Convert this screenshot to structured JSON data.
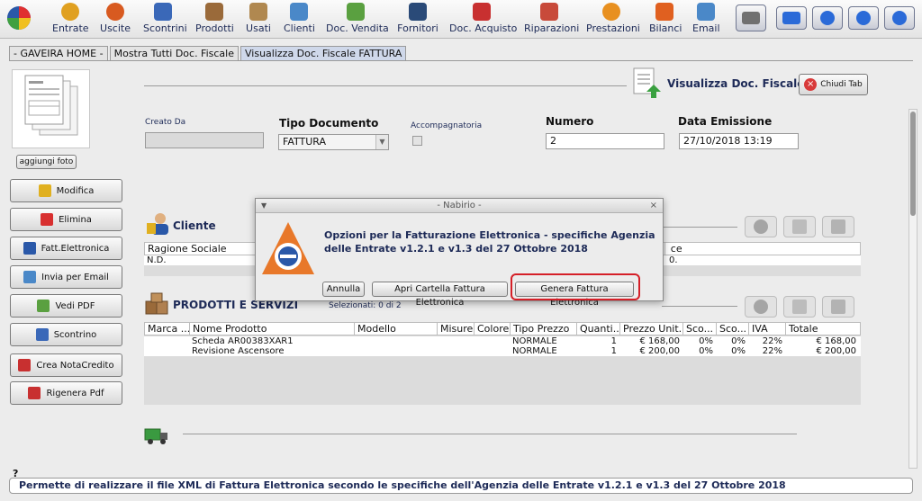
{
  "toolbar": {
    "items": [
      {
        "label": "Entrate",
        "icon": "coin-in-icon",
        "color": "#e0a020"
      },
      {
        "label": "Uscite",
        "icon": "coin-out-icon",
        "color": "#d85a20"
      },
      {
        "label": "Scontrini",
        "icon": "receipt-icon",
        "color": "#3a68b8"
      },
      {
        "label": "Prodotti",
        "icon": "boxes-icon",
        "color": "#9a6a3a"
      },
      {
        "label": "Usati",
        "icon": "open-box-icon",
        "color": "#b08850"
      },
      {
        "label": "Clienti",
        "icon": "customer-icon",
        "color": "#4a88c8"
      },
      {
        "label": "Doc. Vendita",
        "icon": "sale-document-icon",
        "color": "#5aa040"
      },
      {
        "label": "Fornitori",
        "icon": "suppliers-icon",
        "color": "#2a4a78"
      },
      {
        "label": "Doc. Acquisto",
        "icon": "purchase-document-icon",
        "color": "#c83030"
      },
      {
        "label": "Riparazioni",
        "icon": "repair-icon",
        "color": "#c84a3a"
      },
      {
        "label": "Prestazioni",
        "icon": "service-icon",
        "color": "#e89020"
      },
      {
        "label": "Bilanci",
        "icon": "balance-icon",
        "color": "#e06020"
      },
      {
        "label": "Email",
        "icon": "email-icon",
        "color": "#4a88c8"
      }
    ],
    "right_buttons": [
      {
        "name": "cash-register-button",
        "icon": "cash-register-icon"
      },
      {
        "name": "keyboard-button",
        "icon": "keyboard-icon"
      },
      {
        "name": "settings-button",
        "icon": "gear-icon"
      },
      {
        "name": "minimize-button",
        "icon": "minimize-icon"
      },
      {
        "name": "power-button",
        "icon": "power-icon"
      }
    ]
  },
  "tabs": [
    {
      "label": "- GAVEIRA HOME -"
    },
    {
      "label": "Mostra Tutti Doc. Fiscale"
    },
    {
      "label": "Visualizza Doc. Fiscale FATTURA"
    }
  ],
  "sidebar": {
    "add_photo": "aggiungi foto",
    "buttons": [
      {
        "label": "Modifica",
        "icon": "pencil-icon",
        "color": "#e0b020"
      },
      {
        "label": "Elimina",
        "icon": "delete-icon",
        "color": "#d83030"
      },
      {
        "label": "Fatt.Elettronica",
        "icon": "agenzia-entrate-icon",
        "color": "#2a58a8"
      },
      {
        "label": "Invia per Email",
        "icon": "send-email-icon",
        "color": "#4a88c8"
      },
      {
        "label": "Vedi PDF",
        "icon": "document-view-icon",
        "color": "#5aa040"
      },
      {
        "label": "Scontrino",
        "icon": "receipt-icon",
        "color": "#3a68b8"
      },
      {
        "label": "Crea NotaCredito",
        "icon": "credit-note-icon",
        "color": "#c83030"
      },
      {
        "label": "Rigenera Pdf",
        "icon": "pdf-icon",
        "color": "#c83030"
      }
    ]
  },
  "header": {
    "title": "Visualizza Doc. Fiscale",
    "close_tab": "Chiudi Tab"
  },
  "form": {
    "creato_da_label": "Creato Da",
    "creato_da_value": "",
    "tipo_label": "Tipo Documento",
    "tipo_value": "FATTURA",
    "accompagnatoria_label": "Accompagnatoria",
    "numero_label": "Numero",
    "numero_value": "2",
    "data_label": "Data Emissione",
    "data_value": "27/10/2018 13:19"
  },
  "cliente": {
    "title": "Cliente",
    "columns": [
      "Ragione Sociale",
      "",
      "ce"
    ],
    "row": [
      "N.D.",
      "",
      "0."
    ]
  },
  "prodotti": {
    "title": "PRODOTTI E SERVIZI",
    "selected": "Selezionati:   0 di 2",
    "columns": [
      "Marca ...",
      "Nome Prodotto",
      "Modello",
      "Misure",
      "Colore",
      "Tipo Prezzo",
      "Quanti...",
      "Prezzo Unit...",
      "Sco...",
      "Sco...",
      "IVA",
      "Totale"
    ],
    "rows": [
      [
        "",
        "Scheda AR00383XAR1",
        "",
        "",
        "",
        "NORMALE",
        "1",
        "€ 168,00",
        "0%",
        "0%",
        "22%",
        "€ 168,00"
      ],
      [
        "",
        "Revisione Ascensore",
        "",
        "",
        "",
        "NORMALE",
        "1",
        "€ 200,00",
        "0%",
        "0%",
        "22%",
        "€ 200,00"
      ]
    ]
  },
  "dialog": {
    "title": "- Nabirio -",
    "message": "Opzioni per la Fatturazione Elettronica - specifiche Agenzia delle Entrate v1.2.1 e v1.3 del 27 Ottobre 2018",
    "buttons": [
      "Annulla",
      "Apri Cartella Fattura Elettronica",
      "Genera Fattura Elettronica"
    ]
  },
  "status": {
    "help": "?",
    "text": "Permette di realizzare il file XML di Fattura Elettronica secondo le specifiche dell'Agenzia delle Entrate v1.2.1 e v1.3 del 27 Ottobre 2018"
  }
}
